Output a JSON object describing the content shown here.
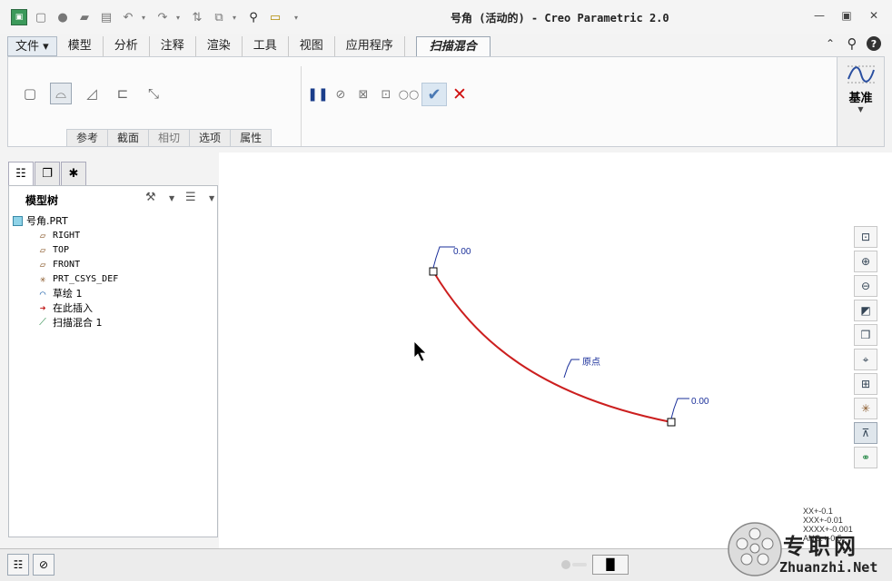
{
  "window": {
    "title": "号角 (活动的) - Creo Parametric 2.0",
    "controls": [
      "minimize",
      "restore",
      "close"
    ]
  },
  "ribbon": {
    "tabs": [
      {
        "label": "文件"
      },
      {
        "label": "模型"
      },
      {
        "label": "分析"
      },
      {
        "label": "注释"
      },
      {
        "label": "渲染"
      },
      {
        "label": "工具"
      },
      {
        "label": "视图"
      },
      {
        "label": "应用程序"
      },
      {
        "label": "扫描混合"
      }
    ],
    "subtabs": [
      {
        "label": "参考"
      },
      {
        "label": "截面"
      },
      {
        "label": "相切"
      },
      {
        "label": "选项"
      },
      {
        "label": "属性"
      }
    ],
    "datum_label": "基准"
  },
  "model_tree": {
    "title": "模型树",
    "items": [
      {
        "label": "号角.PRT",
        "icon": "part-icon"
      },
      {
        "label": "RIGHT",
        "icon": "datum-plane-icon"
      },
      {
        "label": "TOP",
        "icon": "datum-plane-icon"
      },
      {
        "label": "FRONT",
        "icon": "datum-plane-icon"
      },
      {
        "label": "PRT_CSYS_DEF",
        "icon": "csys-icon"
      },
      {
        "label": "草绘 1",
        "icon": "sketch-icon"
      },
      {
        "label": "在此插入",
        "icon": "insert-arrow-icon"
      },
      {
        "label": "扫描混合 1",
        "icon": "sweep-blend-icon"
      }
    ]
  },
  "graphics": {
    "start_label": "0.00",
    "end_label": "0.00",
    "origin_label": "原点",
    "tolerance": [
      "XX+-0.1",
      "XXX+-0.01",
      "XXXX+-0.001",
      "ANG.+-0.5"
    ]
  },
  "watermark": {
    "cn": "专职网",
    "en": "Zhuanzhi.Net"
  },
  "colors": {
    "trajectory": "#cc1f1f",
    "dimension": "#1a2f9a",
    "accept": "#4a79b4",
    "cancel": "#d01010"
  }
}
